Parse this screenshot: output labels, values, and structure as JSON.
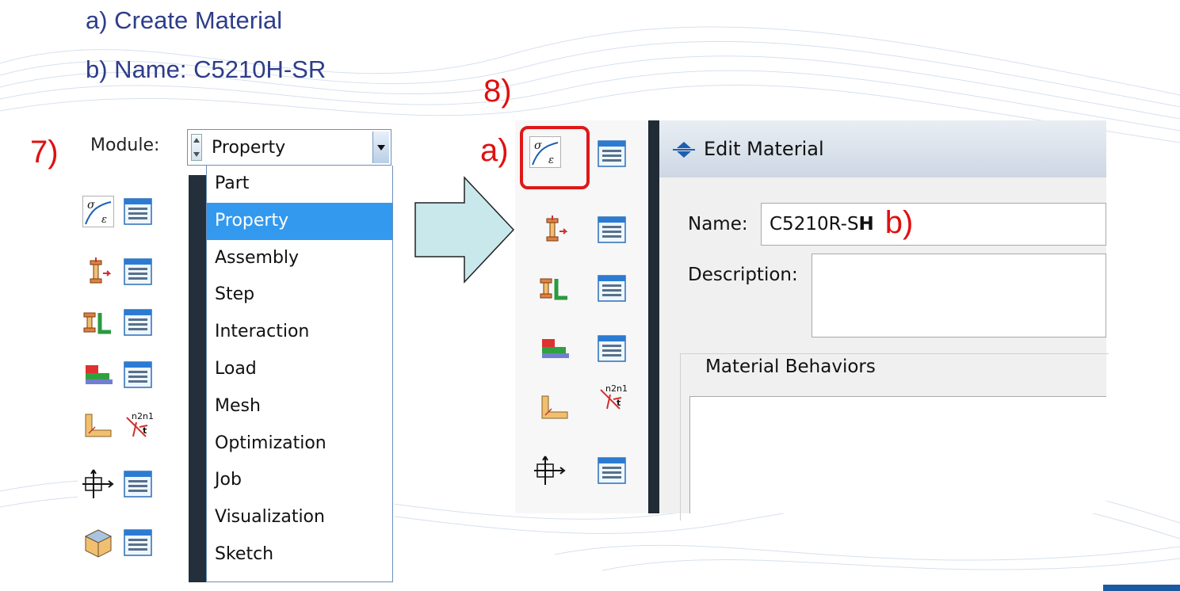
{
  "instructions": {
    "a": "a)  Create Material",
    "b": "b)  Name: C5210H-SR"
  },
  "step_labels": {
    "seven": "7)",
    "eight": "8)",
    "a": "a)",
    "b": "b)"
  },
  "module_selector": {
    "label": "Module:",
    "value": "Property",
    "options": [
      "Part",
      "Property",
      "Assembly",
      "Step",
      "Interaction",
      "Load",
      "Mesh",
      "Optimization",
      "Job",
      "Visualization",
      "Sketch"
    ],
    "selected": "Property"
  },
  "toolbox_icons": [
    "create-material-icon",
    "material-manager-icon",
    "create-section-icon",
    "section-manager-icon",
    "assign-section-icon",
    "section-assignment-manager-icon",
    "create-profile-icon",
    "profile-manager-icon",
    "assign-beam-orientation-icon",
    "assign-beam-normal-icon",
    "skin-icon",
    "skin-manager-icon",
    "special-icon",
    "special-manager-icon"
  ],
  "edit_material_dialog": {
    "title": "Edit Material",
    "name_label": "Name:",
    "name_value_prefix": "C5210R-S",
    "name_value_cursor": "H",
    "description_label": "Description:",
    "description_value": "",
    "behaviors_label": "Material Behaviors"
  },
  "colors": {
    "instruction_text": "#2e3d8a",
    "step_label": "#e01010",
    "highlight_box": "#e01818",
    "selected_item": "#3399ee",
    "arrow_fill": "#c8e8ec"
  }
}
